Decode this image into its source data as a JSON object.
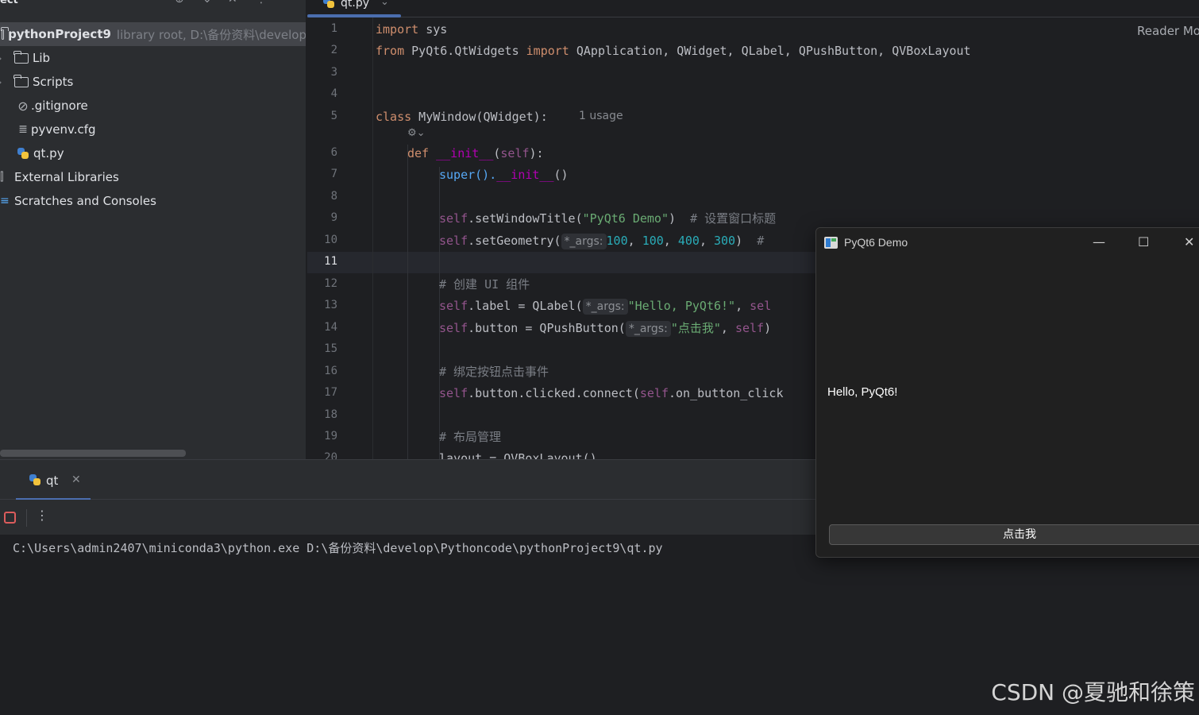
{
  "project_panel": {
    "header_title": "ect",
    "header_icons": [
      "target-icon",
      "chevron-icon",
      "close-icon",
      "kebab-icon"
    ],
    "root": {
      "name": "pythonProject9",
      "hint": "library root, D:\\备份资料\\develop"
    },
    "items": [
      {
        "label": "Lib",
        "icon": "folder-icon"
      },
      {
        "label": "Scripts",
        "icon": "folder-icon"
      },
      {
        "label": ".gitignore",
        "icon": "ignore-icon"
      },
      {
        "label": "pyvenv.cfg",
        "icon": "config-file-icon"
      },
      {
        "label": "qt.py",
        "icon": "python-file-icon"
      },
      {
        "label": "External Libraries",
        "icon": "library-icon"
      },
      {
        "label": "Scratches and Consoles",
        "icon": "scratches-icon"
      }
    ]
  },
  "editor": {
    "tab_label": "qt.py",
    "reader_mode": "Reader Mode",
    "usage_hint": "1 usage",
    "line_numbers": [
      "1",
      "2",
      "3",
      "4",
      "5",
      "6",
      "7",
      "8",
      "9",
      "10",
      "11",
      "12",
      "13",
      "14",
      "15",
      "16",
      "17",
      "18",
      "19",
      "20"
    ],
    "code": {
      "l1_kw": "import",
      "l1_rest": " sys",
      "l2_kw1": "from",
      "l2_mod": " PyQt6.QtWidgets ",
      "l2_kw2": "import",
      "l2_rest": " QApplication, QWidget, QLabel, QPushButton, QVBoxLayout",
      "l5_kw": "class",
      "l5_rest": " MyWindow(QWidget):",
      "l6_kw": "def",
      "l6_fn": "__init__",
      "l6_p1": "(",
      "l6_self": "self",
      "l6_p2": "):",
      "l7_a": "super().",
      "l7_fn": "__init__",
      "l7_b": "()",
      "l9_self": "self",
      "l9_a": ".setWindowTitle(",
      "l9_str": "\"PyQt6 Demo\"",
      "l9_b": ")  ",
      "l9_cmt": "# 设置窗口标题",
      "l10_self": "self",
      "l10_a": ".setGeometry(",
      "l10_hint": "*_args:",
      "l10_n1": "100",
      "l10_s1": ", ",
      "l10_n2": "100",
      "l10_s2": ", ",
      "l10_n3": "400",
      "l10_s3": ", ",
      "l10_n4": "300",
      "l10_b": ")  ",
      "l10_cmt": "#",
      "l12_cmt": "# 创建 UI 组件",
      "l13_self": "self",
      "l13_a": ".label = QLabel(",
      "l13_hint": "*_args:",
      "l13_str": "\"Hello, PyQt6!\"",
      "l13_b": ", ",
      "l13_self2": "sel",
      "l14_self": "self",
      "l14_a": ".button = QPushButton(",
      "l14_hint": "*_args:",
      "l14_str": "\"点击我\"",
      "l14_b": ", ",
      "l14_self2": "self",
      "l14_c": ")",
      "l16_cmt": "# 绑定按钮点击事件",
      "l17_self": "self",
      "l17_a": ".button.clicked.connect(",
      "l17_self2": "self",
      "l17_b": ".on_button_click",
      "l19_cmt": "# 布局管理",
      "l20_text": "layout = QVBoxLayout()"
    }
  },
  "run_panel": {
    "tab_label": "qt",
    "console_output": "C:\\Users\\admin2407\\miniconda3\\python.exe D:\\备份资料\\develop\\Pythoncode\\pythonProject9\\qt.py"
  },
  "qt_window": {
    "title": "PyQt6 Demo",
    "label_text": "Hello, PyQt6!",
    "button_text": "点击我",
    "minimize": "—",
    "maximize": "☐",
    "close": "✕"
  },
  "watermark": "CSDN @夏驰和徐策"
}
